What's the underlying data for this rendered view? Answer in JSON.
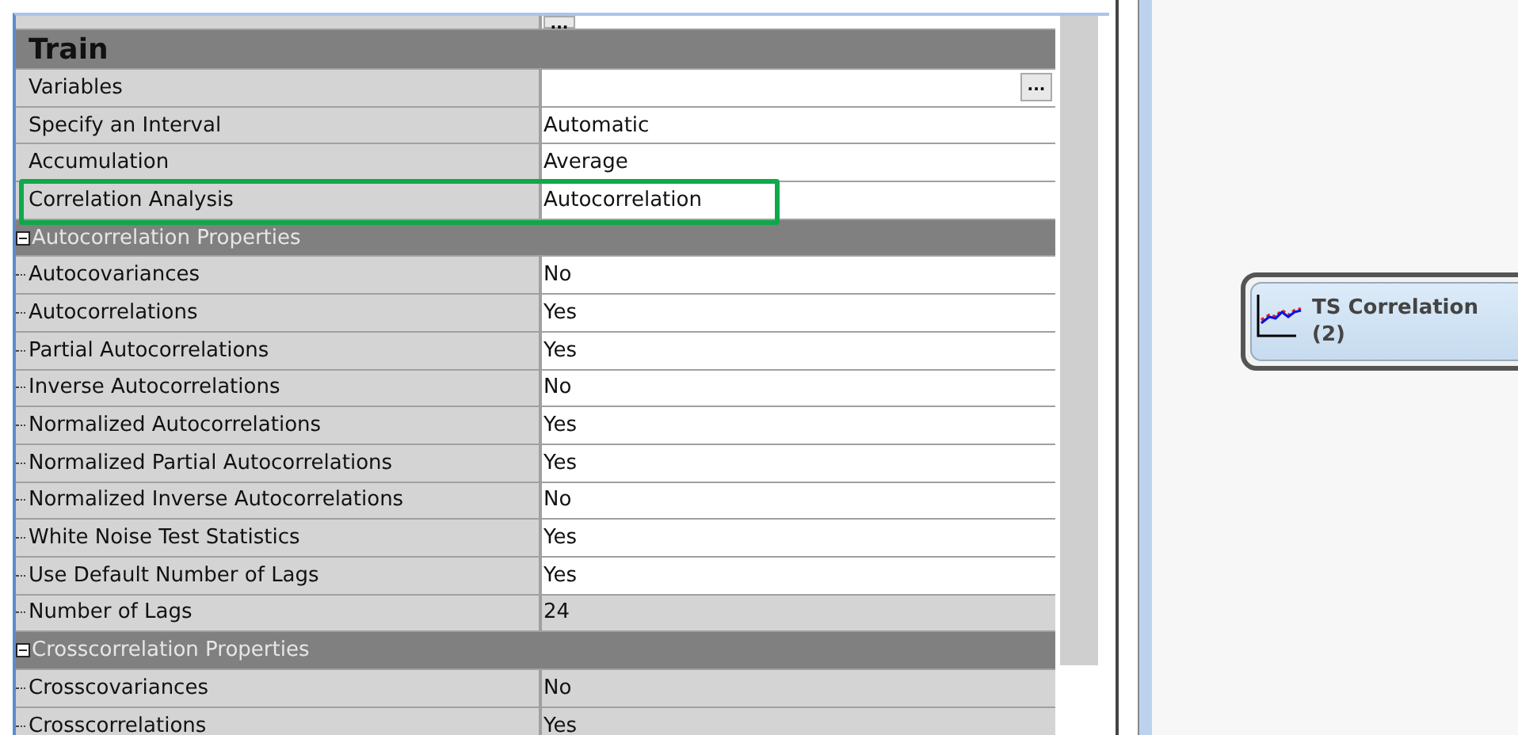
{
  "properties": {
    "top_row": {
      "button": "..."
    },
    "section_title": "Train",
    "rows": [
      {
        "kind": "property",
        "label": "Variables",
        "value": "",
        "button": "...",
        "editable": true,
        "highlighted": false
      },
      {
        "kind": "property",
        "label": "Specify an Interval",
        "value": "Automatic",
        "editable": true,
        "highlighted": false
      },
      {
        "kind": "property",
        "label": "Accumulation",
        "value": "Average",
        "editable": true,
        "highlighted": false
      },
      {
        "kind": "property",
        "label": "Correlation Analysis",
        "value": "Autocorrelation",
        "editable": true,
        "highlighted": true
      },
      {
        "kind": "group",
        "label": "Autocorrelation Properties",
        "expanded": true,
        "children": [
          {
            "label": "Autocovariances",
            "value": "No",
            "editable": true
          },
          {
            "label": "Autocorrelations",
            "value": "Yes",
            "editable": true
          },
          {
            "label": "Partial Autocorrelations",
            "value": "Yes",
            "editable": true
          },
          {
            "label": "Inverse Autocorrelations",
            "value": "No",
            "editable": true
          },
          {
            "label": "Normalized Autocorrelations",
            "value": "Yes",
            "editable": true
          },
          {
            "label": "Normalized Partial Autocorrelations",
            "value": "Yes",
            "editable": true
          },
          {
            "label": "Normalized Inverse Autocorrelations",
            "value": "No",
            "editable": true
          },
          {
            "label": "White Noise Test Statistics",
            "value": "Yes",
            "editable": true
          },
          {
            "label": "Use Default Number of Lags",
            "value": "Yes",
            "editable": true
          },
          {
            "label": "Number of Lags",
            "value": "24",
            "editable": false
          }
        ]
      },
      {
        "kind": "group",
        "label": "Crosscorrelation Properties",
        "expanded": true,
        "children": [
          {
            "label": "Crosscovariances",
            "value": "No",
            "editable": false
          },
          {
            "label": "Crosscorrelations",
            "value": "Yes",
            "editable": false
          }
        ]
      }
    ]
  },
  "diagram": {
    "nodes": [
      {
        "label": "TS Correlation (2)"
      }
    ]
  }
}
